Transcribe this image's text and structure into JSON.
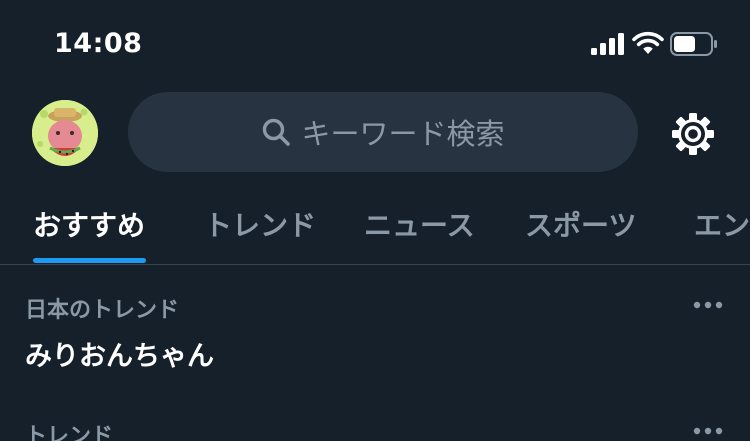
{
  "status_bar": {
    "time": "14:08",
    "icons": [
      "signal-icon",
      "wifi-icon",
      "battery-icon"
    ]
  },
  "header": {
    "avatar": "avatar",
    "search": {
      "placeholder": "キーワード検索",
      "icon": "search-icon"
    },
    "settings_icon": "gear-icon"
  },
  "tabs": [
    {
      "label": "おすすめ",
      "active": true
    },
    {
      "label": "トレンド",
      "active": false
    },
    {
      "label": "ニュース",
      "active": false
    },
    {
      "label": "スポーツ",
      "active": false
    },
    {
      "label": "エン",
      "active": false
    }
  ],
  "trends": [
    {
      "context": "日本のトレンド",
      "title": "みりおんちゃん",
      "more_icon": "more-icon"
    },
    {
      "context": "トレンド",
      "title": "",
      "more_icon": "more-icon"
    }
  ],
  "colors": {
    "background": "#15202b",
    "search_background": "#273340",
    "accent": "#1d9bf0",
    "secondary_text": "#8b98a5",
    "divider": "#38444d"
  }
}
